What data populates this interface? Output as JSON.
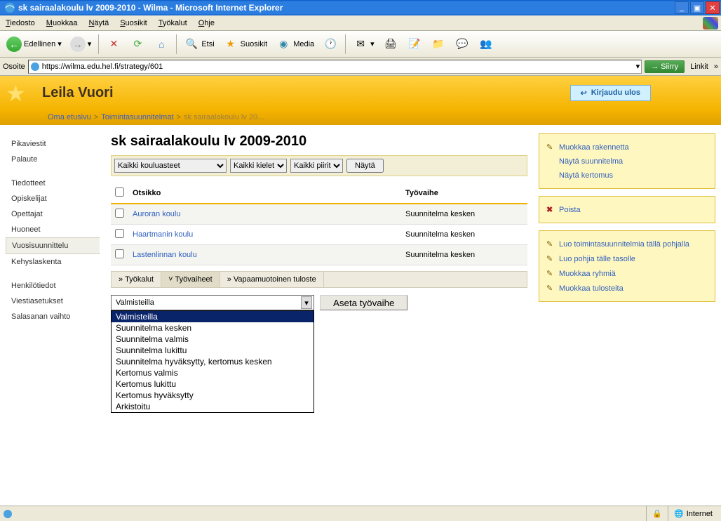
{
  "window": {
    "title": "sk sairaalakoulu lv 2009-2010 - Wilma - Microsoft Internet Explorer"
  },
  "menubar": [
    "Tiedosto",
    "Muokkaa",
    "Näytä",
    "Suosikit",
    "Työkalut",
    "Ohje"
  ],
  "toolbar": {
    "back": "Edellinen",
    "search": "Etsi",
    "favorites": "Suosikit",
    "media": "Media"
  },
  "address": {
    "label": "Osoite",
    "url": "https://wilma.edu.hel.fi/strategy/601",
    "go": "Siirry",
    "links": "Linkit"
  },
  "header": {
    "username": "Leila Vuori",
    "logout": "Kirjaudu ulos"
  },
  "breadcrumb": {
    "home": "Oma etusivu",
    "plans": "Toimintasuunnitelmat",
    "current": "sk sairaalakoulu lv 20..."
  },
  "leftnav": {
    "pikaviestit": "Pikaviestit",
    "palaute": "Palaute",
    "tiedotteet": "Tiedotteet",
    "opiskelijat": "Opiskelijat",
    "opettajat": "Opettajat",
    "huoneet": "Huoneet",
    "vuosisuunnittelu": "Vuosisuunnittelu",
    "kehyslaskenta": "Kehyslaskenta",
    "henkilotiedot": "Henkilötiedot",
    "viestiasetukset": "Viestiasetukset",
    "salasanan": "Salasanan vaihto"
  },
  "page_title": "sk sairaalakoulu lv 2009-2010",
  "filters": {
    "schoollevels": "Kaikki kouluasteet",
    "languages": "Kaikki kielet",
    "districts": "Kaikki piirit",
    "show": "Näytä"
  },
  "table": {
    "col_title": "Otsikko",
    "col_stage": "Työvaihe",
    "rows": [
      {
        "title": "Auroran koulu",
        "stage": "Suunnitelma kesken"
      },
      {
        "title": "Haartmanin koulu",
        "stage": "Suunnitelma kesken"
      },
      {
        "title": "Lastenlinnan koulu",
        "stage": "Suunnitelma kesken"
      }
    ]
  },
  "tabs": {
    "tools": "Työkalut",
    "stages": "Työvaiheet",
    "freeform": "Vapaamuotoinen tuloste"
  },
  "stage_select": {
    "selected": "Valmisteilla",
    "options": [
      "Valmisteilla",
      "Suunnitelma kesken",
      "Suunnitelma valmis",
      "Suunnitelma lukittu",
      "Suunnitelma hyväksytty, kertomus kesken",
      "Kertomus valmis",
      "Kertomus lukittu",
      "Kertomus hyväksytty",
      "Arkistoitu"
    ],
    "set_button": "Aseta työvaihe"
  },
  "right": {
    "edit_structure": "Muokkaa rakennetta",
    "show_plan": "Näytä suunnitelma",
    "show_report": "Näytä kertomus",
    "delete": "Poista",
    "create_plans": "Luo toimintasuunnitelmia tällä pohjalla",
    "create_templates": "Luo pohjia tälle tasolle",
    "edit_groups": "Muokkaa ryhmiä",
    "edit_outputs": "Muokkaa tulosteita"
  },
  "status": {
    "zone": "Internet"
  }
}
